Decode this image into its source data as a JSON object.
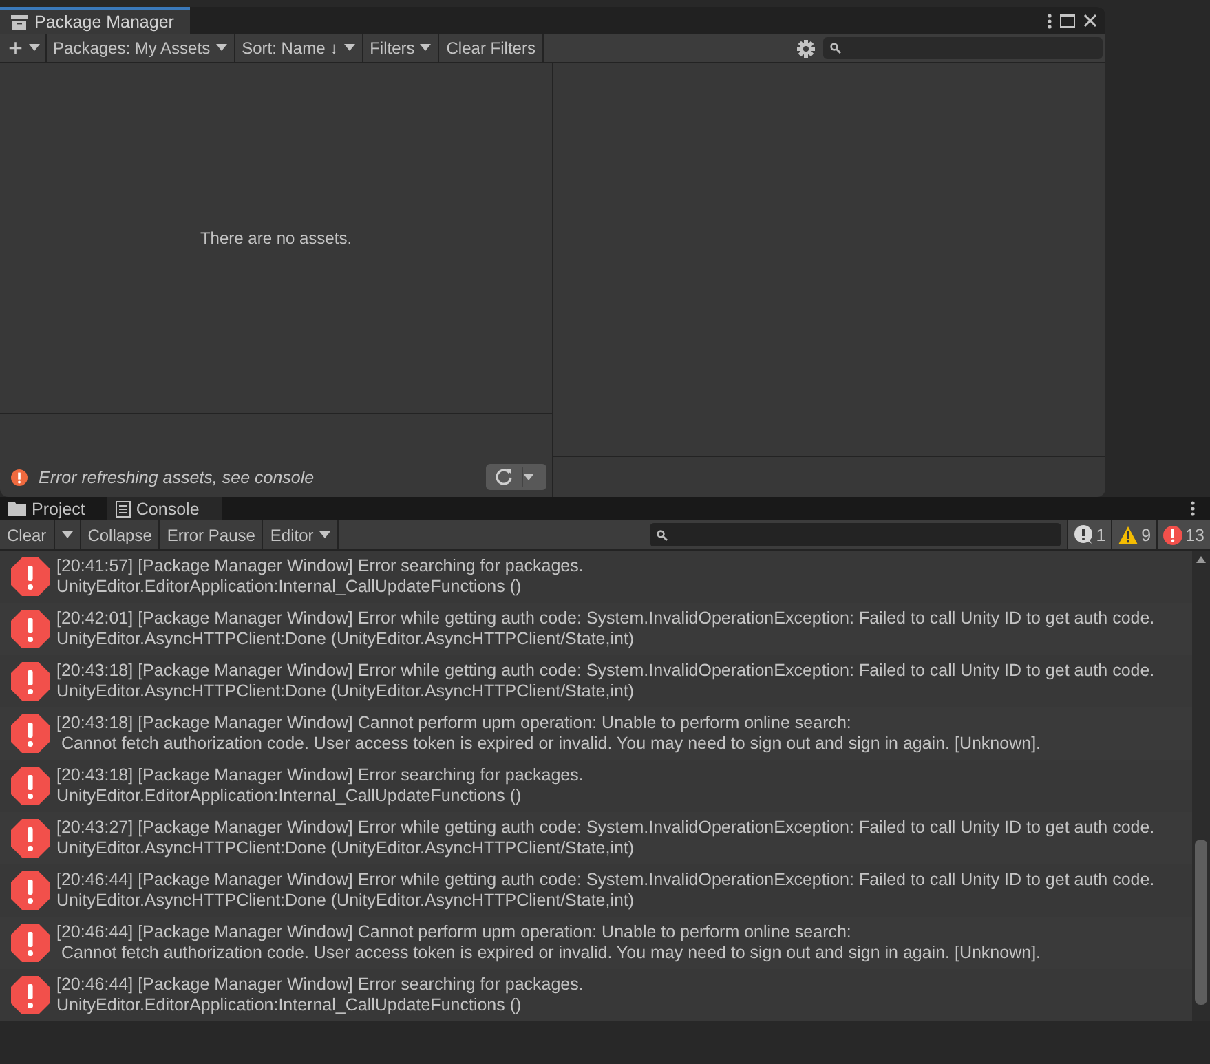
{
  "package_manager": {
    "title": "Package Manager",
    "toolbar": [
      {
        "kind": "add",
        "label": "+"
      },
      {
        "kind": "dropdown",
        "label": "Packages: My Assets"
      },
      {
        "kind": "dropdown",
        "label": "Sort: Name ↓"
      },
      {
        "kind": "dropdown",
        "label": "Filters"
      },
      {
        "kind": "button",
        "label": "Clear Filters"
      }
    ],
    "empty_message": "There are no assets.",
    "status": "Error refreshing assets, see console"
  },
  "console": {
    "tabs": [
      {
        "label": "Project",
        "kind": "folder",
        "selected": false
      },
      {
        "label": "Console",
        "kind": "console",
        "selected": true
      }
    ],
    "toolbar": [
      {
        "kind": "split",
        "label": "Clear"
      },
      {
        "kind": "button",
        "label": "Collapse"
      },
      {
        "kind": "button",
        "label": "Error Pause"
      },
      {
        "kind": "dropdown",
        "label": "Editor"
      }
    ],
    "counters": [
      {
        "kind": "info",
        "count": "1"
      },
      {
        "kind": "warning",
        "count": "9"
      },
      {
        "kind": "error",
        "count": "13"
      }
    ],
    "entries": [
      {
        "message": "[20:41:57] [Package Manager Window] Error searching for packages.",
        "detail": "UnityEditor.EditorApplication:Internal_CallUpdateFunctions ()"
      },
      {
        "message": "[20:42:01] [Package Manager Window] Error while getting auth code: System.InvalidOperationException: Failed to call Unity ID to get auth code.",
        "detail": "UnityEditor.AsyncHTTPClient:Done (UnityEditor.AsyncHTTPClient/State,int)"
      },
      {
        "message": "[20:43:18] [Package Manager Window] Error while getting auth code: System.InvalidOperationException: Failed to call Unity ID to get auth code.",
        "detail": "UnityEditor.AsyncHTTPClient:Done (UnityEditor.AsyncHTTPClient/State,int)"
      },
      {
        "message": "[20:43:18] [Package Manager Window] Cannot perform upm operation: Unable to perform online search:",
        "detail": " Cannot fetch authorization code. User access token is expired or invalid. You may need to sign out and sign in again. [Unknown]."
      },
      {
        "message": "[20:43:18] [Package Manager Window] Error searching for packages.",
        "detail": "UnityEditor.EditorApplication:Internal_CallUpdateFunctions ()"
      },
      {
        "message": "[20:43:27] [Package Manager Window] Error while getting auth code: System.InvalidOperationException: Failed to call Unity ID to get auth code.",
        "detail": "UnityEditor.AsyncHTTPClient:Done (UnityEditor.AsyncHTTPClient/State,int)"
      },
      {
        "message": "[20:46:44] [Package Manager Window] Error while getting auth code: System.InvalidOperationException: Failed to call Unity ID to get auth code.",
        "detail": "UnityEditor.AsyncHTTPClient:Done (UnityEditor.AsyncHTTPClient/State,int)"
      },
      {
        "message": "[20:46:44] [Package Manager Window] Cannot perform upm operation: Unable to perform online search:",
        "detail": " Cannot fetch authorization code. User access token is expired or invalid. You may need to sign out and sign in again. [Unknown]."
      },
      {
        "message": "[20:46:44] [Package Manager Window] Error searching for packages.",
        "detail": "UnityEditor.EditorApplication:Internal_CallUpdateFunctions ()"
      }
    ]
  }
}
